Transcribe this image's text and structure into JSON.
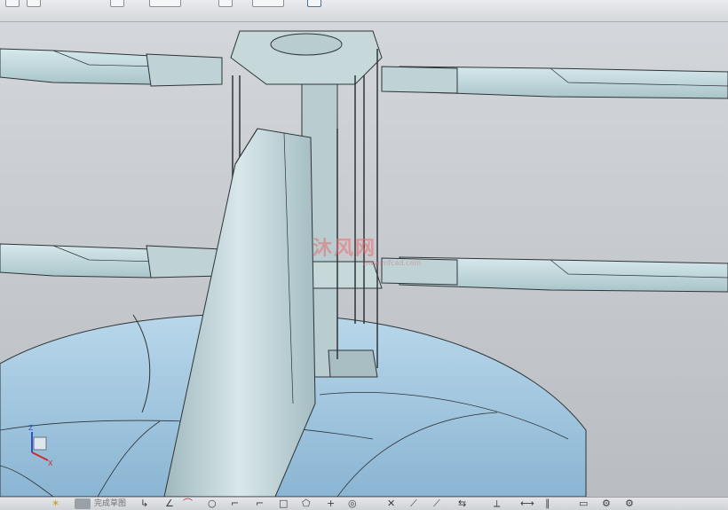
{
  "toolbar_bottom": {
    "finish_sketch_label": "完成草图"
  },
  "watermark": {
    "text": "沐风网",
    "url": "www.mfcad.com"
  },
  "axes_triad": {
    "z_label": "Z",
    "x_label": "X"
  },
  "colors": {
    "blade": "#c6dde1",
    "fuselage": "#a8cbe1",
    "background": "#c9cdd2",
    "edge": "#2e3438"
  }
}
